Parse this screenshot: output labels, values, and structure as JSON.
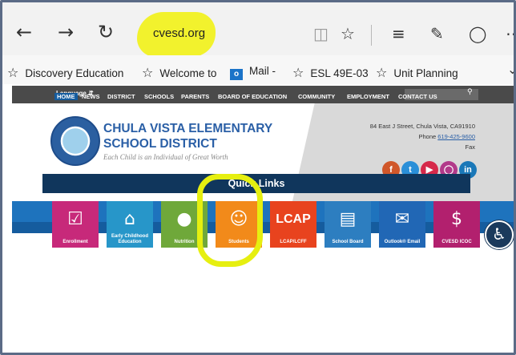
{
  "browser": {
    "url": "cvesd.org",
    "favorites": [
      {
        "label": "Discovery Education"
      },
      {
        "label": "Welcome to"
      },
      {
        "label": "Mail -"
      },
      {
        "label": "ESL 49E-03"
      },
      {
        "label": "Unit Planning"
      }
    ]
  },
  "site": {
    "language_label": "Language",
    "school_name_line1": "CHULA VISTA ELEMENTARY",
    "school_name_line2": "SCHOOL DISTRICT",
    "motto": "Each Child is an Individual of Great Worth",
    "address": "84 East J Street, Chula Vista, CA91910",
    "phone_label": "Phone",
    "phone": "619-425-9600",
    "fax_label": "Fax",
    "nav": [
      "HOME",
      "NEWS",
      "DISTRICT",
      "SCHOOLS",
      "PARENTS",
      "BOARD OF EDUCATION",
      "COMMUNITY",
      "EMPLOYMENT",
      "CONTACT US"
    ],
    "quick_links_title": "Quick Links",
    "quick_links": [
      {
        "label": "Enrollment",
        "icon": "clipboard-check-icon",
        "color": "#c7297a"
      },
      {
        "label": "Early Childhood Education",
        "icon": "school-building-icon",
        "color": "#2796c9"
      },
      {
        "label": "Nutrition",
        "icon": "apple-icon",
        "color": "#6fa83a"
      },
      {
        "label": "Students",
        "icon": "student-reading-icon",
        "color": "#f28a1a"
      },
      {
        "label": "LCAP/LCFF",
        "icon": "lcap-logo-icon",
        "color": "#e8431e"
      },
      {
        "label": "School Board",
        "icon": "podium-icon",
        "color": "#2d7ec0"
      },
      {
        "label": "Outlook® Email",
        "icon": "outlook-icon",
        "color": "#2167b5"
      },
      {
        "label": "CVESD ICOC",
        "icon": "money-hardhat-icon",
        "color": "#b2206e"
      }
    ]
  },
  "colors": {
    "brand_blue": "#2a5fa6",
    "nav_blue": "#1e73bd",
    "quick_links_bar": "#10365c",
    "highlight": "#f2f20a"
  }
}
